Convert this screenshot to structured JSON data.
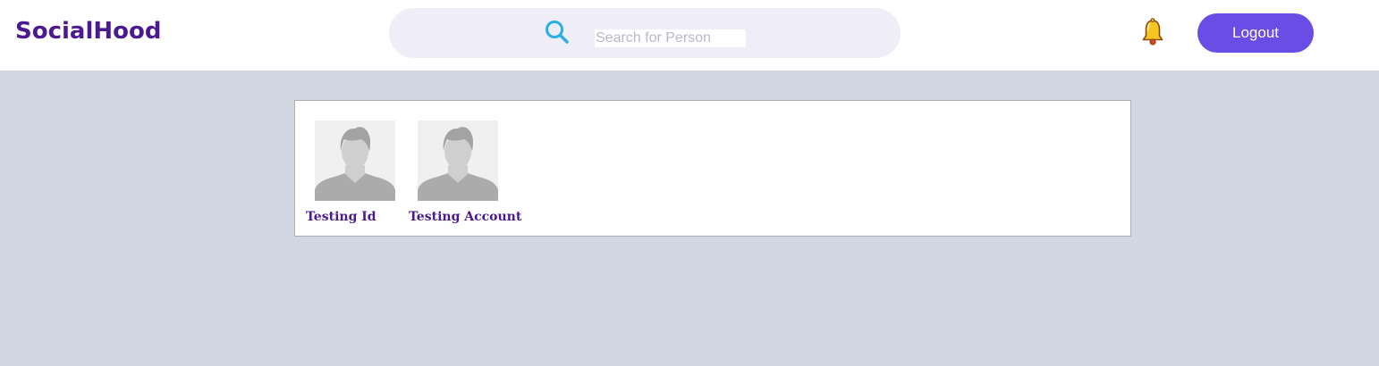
{
  "app": {
    "title": "SocialHood"
  },
  "search": {
    "placeholder": "Search for Person",
    "value": ""
  },
  "header": {
    "logout_label": "Logout"
  },
  "results": {
    "people": [
      {
        "name": "Testing Id"
      },
      {
        "name": "Testing Account"
      }
    ]
  },
  "colors": {
    "brand": "#4b1a8f",
    "accent": "#6a4de4",
    "search_icon": "#2bb0e6",
    "page_bg": "#d1d7e2"
  }
}
